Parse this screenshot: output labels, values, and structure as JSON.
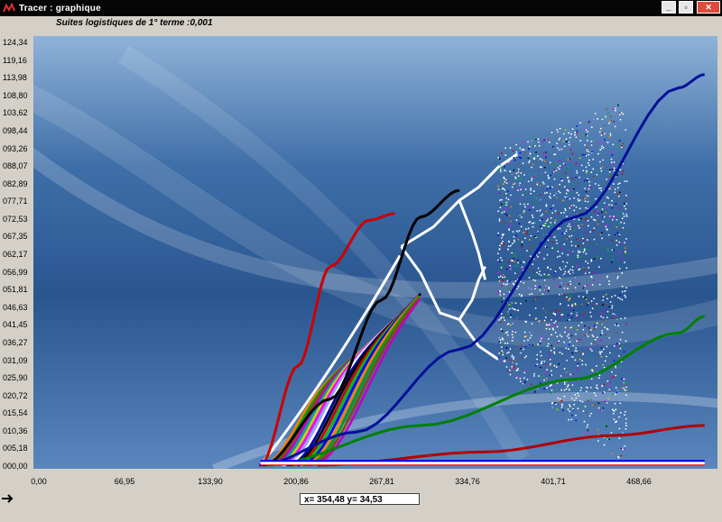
{
  "window": {
    "title": "Tracer : graphique"
  },
  "chart_data": {
    "type": "line",
    "title": "Suites logistiques de 1° terme :0,001",
    "xlabel": "",
    "ylabel": "",
    "xlim": [
      0,
      530
    ],
    "ylim": [
      0,
      128
    ],
    "x_ticks": [
      "0,00",
      "66,95",
      "133,90",
      "200,86",
      "267,81",
      "334,76",
      "401,71",
      "468,66"
    ],
    "y_ticks": [
      "124,34",
      "119,16",
      "113,98",
      "108,80",
      "103,62",
      "098,44",
      "093,26",
      "088,07",
      "082,89",
      "077,71",
      "072,53",
      "067,35",
      "062,17",
      "056,99",
      "051,81",
      "046,63",
      "041,45",
      "036,27",
      "031,09",
      "025,90",
      "020,72",
      "015,54",
      "010,36",
      "005,18",
      "000,00"
    ],
    "grid": false,
    "colors": [
      "#ff7f00",
      "#00a000",
      "#8b4513",
      "#c000c0",
      "#00a0a0",
      "#d0d000",
      "#ff00ff",
      "#a0a0ff",
      "#ffffff",
      "#0000a0",
      "#000000",
      "#cc0000",
      "#00c000",
      "#0000ff"
    ],
    "notes_series": [
      {
        "color": "#00109a",
        "points": [
          [
            175,
            0
          ],
          [
            250,
            10
          ],
          [
            330,
            35
          ],
          [
            420,
            75
          ],
          [
            500,
            114
          ],
          [
            520,
            118
          ]
        ]
      },
      {
        "color": "#008000",
        "points": [
          [
            180,
            0
          ],
          [
            300,
            12
          ],
          [
            420,
            26
          ],
          [
            500,
            40
          ],
          [
            520,
            45
          ]
        ]
      },
      {
        "color": "#b00000",
        "points": [
          [
            220,
            0
          ],
          [
            350,
            4
          ],
          [
            450,
            9
          ],
          [
            520,
            12
          ]
        ]
      },
      {
        "color": "#000000",
        "points": [
          [
            178,
            0
          ],
          [
            230,
            20
          ],
          [
            270,
            50
          ],
          [
            300,
            75
          ],
          [
            330,
            83
          ]
        ]
      },
      {
        "color": "#cc0000",
        "points": [
          [
            176,
            0
          ],
          [
            205,
            30
          ],
          [
            230,
            60
          ],
          [
            260,
            74
          ],
          [
            280,
            76
          ]
        ]
      }
    ]
  },
  "statusbar": {
    "coordinates": "x= 354,48  y= 34,53"
  }
}
